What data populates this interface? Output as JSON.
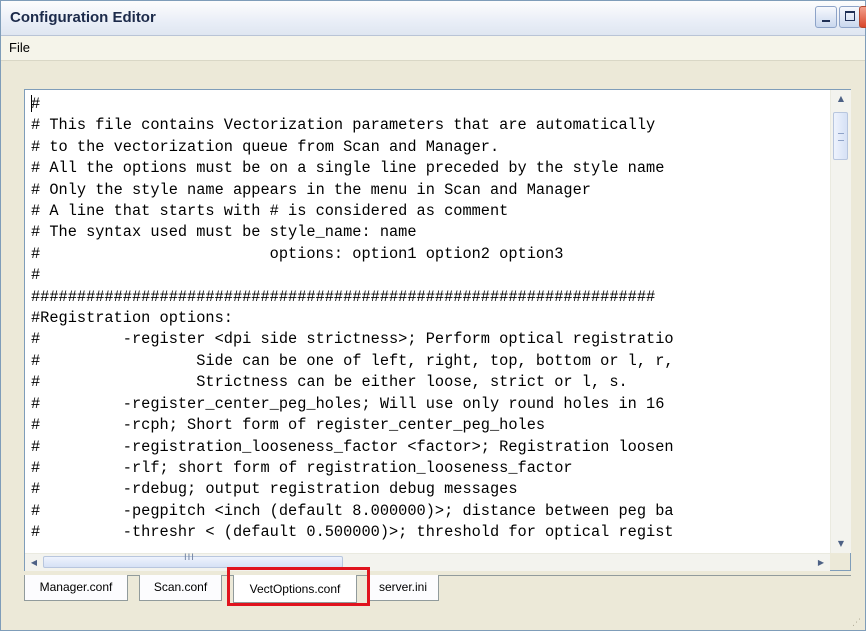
{
  "window": {
    "title": "Configuration Editor"
  },
  "menu": {
    "file_label": "File"
  },
  "editor": {
    "content": "#\n# This file contains Vectorization parameters that are automatically\n# to the vectorization queue from Scan and Manager.\n# All the options must be on a single line preceded by the style name\n# Only the style name appears in the menu in Scan and Manager\n# A line that starts with # is considered as comment\n# The syntax used must be style_name: name\n#                         options: option1 option2 option3\n#\n####################################################################\n#Registration options:\n#         -register <dpi side strictness>; Perform optical registratio\n#                 Side can be one of left, right, top, bottom or l, r,\n#                 Strictness can be either loose, strict or l, s.\n#         -register_center_peg_holes; Will use only round holes in 16\n#         -rcph; Short form of register_center_peg_holes\n#         -registration_looseness_factor <factor>; Registration loosen\n#         -rlf; short form of registration_looseness_factor\n#         -rdebug; output registration debug messages\n#         -pegpitch <inch (default 8.000000)>; distance between peg ba\n#         -threshr < (default 0.500000)>; threshold for optical regist"
  },
  "tabs": [
    {
      "label": "Manager.conf"
    },
    {
      "label": "Scan.conf"
    },
    {
      "label": "VectOptions.conf",
      "active": true
    },
    {
      "label": "server.ini"
    }
  ],
  "scrollbar": {
    "h_grip": "III"
  },
  "colors": {
    "highlight": "#e0141e",
    "window_bg": "#ece9d8",
    "border": "#7f9db9"
  }
}
